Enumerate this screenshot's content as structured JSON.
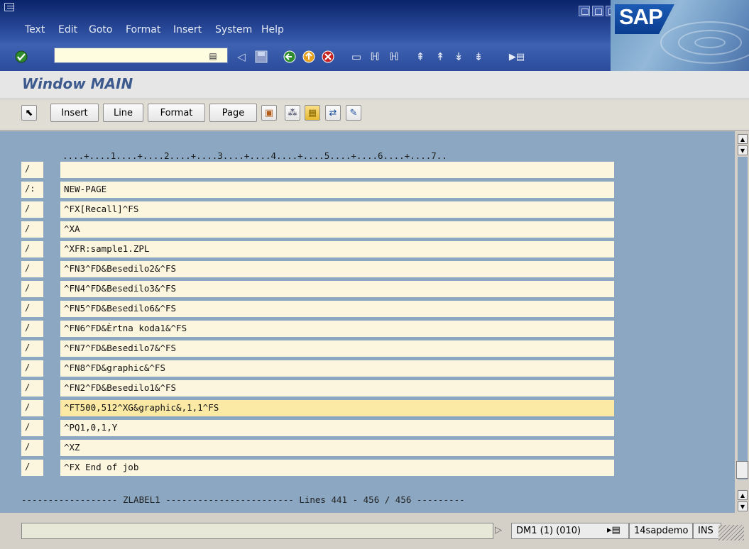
{
  "menubar": {
    "items": [
      "Text",
      "Edit",
      "Goto",
      "Format",
      "Insert",
      "System",
      "Help"
    ]
  },
  "logo": {
    "text": "SAP"
  },
  "toolbar": {
    "okcode_value": "",
    "icons": [
      "enter-icon",
      "favorites-icon",
      "back-nav-icon",
      "save-icon",
      "back-icon",
      "exit-icon",
      "cancel-icon",
      "print-icon",
      "find-icon",
      "find-next-icon",
      "first-page-icon",
      "previous-page-icon",
      "next-page-icon",
      "last-page-icon",
      "layout-menu-icon"
    ]
  },
  "title": {
    "text": "Window MAIN"
  },
  "apptoolbar": {
    "buttons": [
      "Insert",
      "Line",
      "Format",
      "Page"
    ]
  },
  "editor": {
    "ruler": "....+....1....+....2....+....3....+....4....+....5....+....6....+....7..",
    "lines": [
      {
        "marker": "/",
        "text": ""
      },
      {
        "marker": "/:",
        "text": "NEW-PAGE"
      },
      {
        "marker": "/",
        "text": "^FX[Recall]^FS"
      },
      {
        "marker": "/",
        "text": "^XA"
      },
      {
        "marker": "/",
        "text": "^XFR:sample1.ZPL"
      },
      {
        "marker": "/",
        "text": "^FN3^FD&Besedilo2&^FS"
      },
      {
        "marker": "/",
        "text": "^FN4^FD&Besedilo3&^FS"
      },
      {
        "marker": "/",
        "text": "^FN5^FD&Besedilo6&^FS"
      },
      {
        "marker": "/",
        "text": "^FN6^FD&Èrtna koda1&^FS"
      },
      {
        "marker": "/",
        "text": "^FN7^FD&Besedilo7&^FS"
      },
      {
        "marker": "/",
        "text": "^FN8^FD&graphic&^FS"
      },
      {
        "marker": "/",
        "text": "^FN2^FD&Besedilo1&^FS"
      },
      {
        "marker": "/",
        "text": "^FT500,512^XG&graphic&,1,1^FS",
        "selected": true
      },
      {
        "marker": "/",
        "text": "^PQ1,0,1,Y"
      },
      {
        "marker": "/",
        "text": "^XZ"
      },
      {
        "marker": "/",
        "text": "^FX End of job"
      }
    ],
    "footer": "------------------ ZLABEL1 ------------------------ Lines 441 - 456 / 456 ---------"
  },
  "statusbar": {
    "system": "DM1 (1) (010)",
    "server": "14sapdemo",
    "mode": "INS"
  }
}
